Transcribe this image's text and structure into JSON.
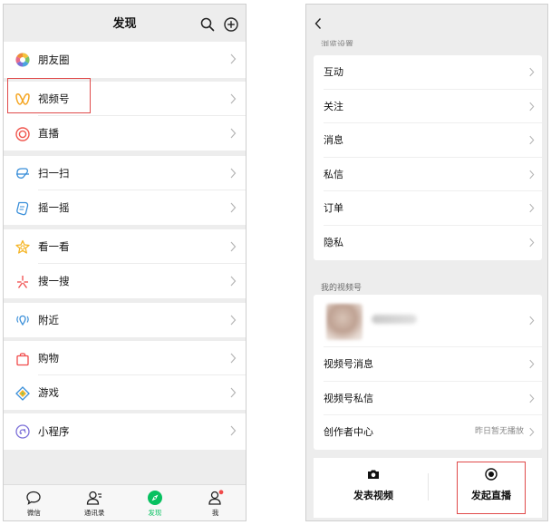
{
  "left": {
    "title": "发现",
    "groups": [
      [
        "朋友圈"
      ],
      [
        "视频号",
        "直播"
      ],
      [
        "扫一扫",
        "摇一摇"
      ],
      [
        "看一看",
        "搜一搜"
      ],
      [
        "附近"
      ],
      [
        "购物",
        "游戏"
      ],
      [
        "小程序"
      ]
    ],
    "icons": {
      "朋友圈": "moments-icon",
      "视频号": "channels-icon",
      "直播": "live-icon",
      "扫一扫": "scan-icon",
      "摇一摇": "shake-icon",
      "看一看": "top-stories-icon",
      "搜一搜": "search-discover-icon",
      "附近": "nearby-icon",
      "购物": "shopping-icon",
      "游戏": "games-icon",
      "小程序": "mini-programs-icon"
    },
    "tabs": [
      {
        "label": "微信",
        "active": false
      },
      {
        "label": "通讯录",
        "active": false
      },
      {
        "label": "发现",
        "active": true
      },
      {
        "label": "我",
        "active": false,
        "badge": true
      }
    ],
    "highlighted_item": "视频号"
  },
  "right": {
    "cut_section_title": "浏览设置",
    "settings_items": [
      "互动",
      "关注",
      "消息",
      "私信",
      "订单",
      "隐私"
    ],
    "my_channel_title": "我的视频号",
    "channel_items": [
      {
        "label": "视频号消息",
        "value": ""
      },
      {
        "label": "视频号私信",
        "value": ""
      },
      {
        "label": "创作者中心",
        "value": "昨日暂无播放"
      }
    ],
    "actions": [
      {
        "label": "发表视频",
        "icon": "camera-icon"
      },
      {
        "label": "发起直播",
        "icon": "record-icon"
      }
    ],
    "highlighted_action": "发起直播"
  },
  "colors": {
    "accent_green": "#07c160",
    "highlight_red": "#e04a4a",
    "background": "#ededed"
  }
}
